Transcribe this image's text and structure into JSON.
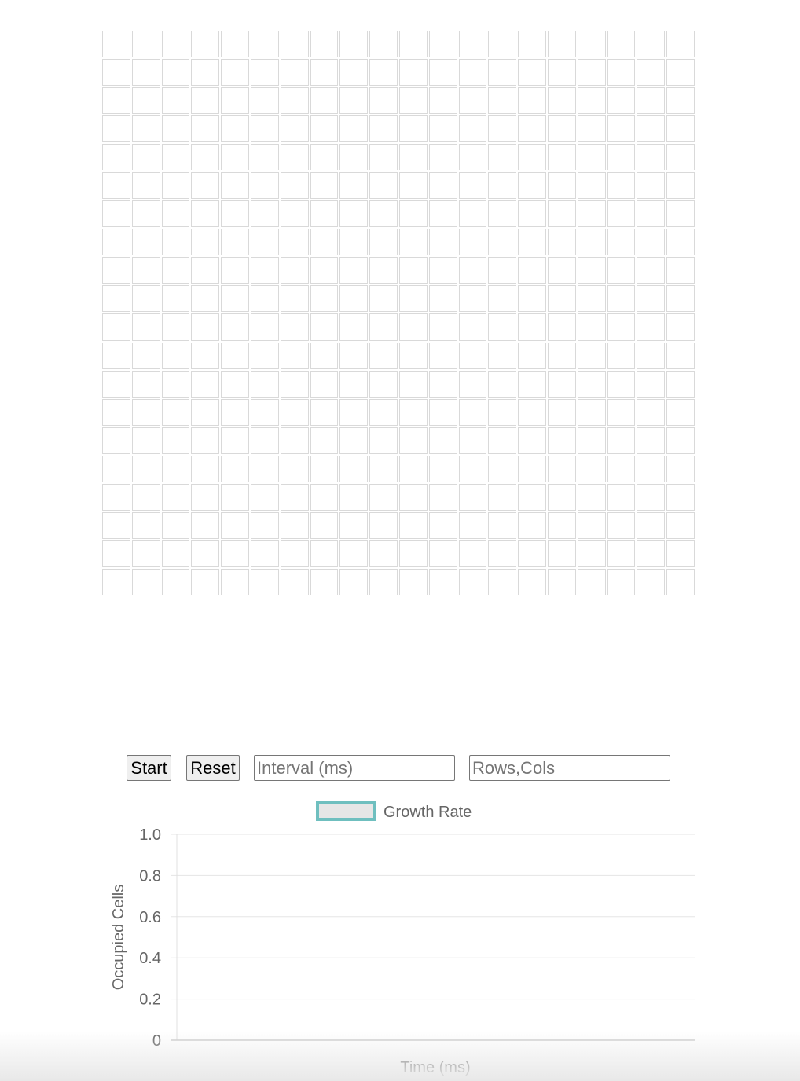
{
  "grid": {
    "rows": 20,
    "cols": 20
  },
  "controls": {
    "start_label": "Start",
    "reset_label": "Reset",
    "interval_placeholder": "Interval (ms)",
    "rows_cols_placeholder": "Rows,Cols"
  },
  "colors": {
    "series_border": "#6fbfbf",
    "series_fill": "#e6e6e6",
    "grid_line": "#e5e5e5",
    "axis_text": "#666666"
  },
  "chart_data": {
    "type": "line",
    "series": [
      {
        "name": "Growth Rate",
        "x": [],
        "values": []
      }
    ],
    "xlabel": "Time (ms)",
    "ylabel": "Occupied Cells",
    "ylim": [
      0,
      1
    ],
    "yticks": [
      "0",
      "0.2",
      "0.4",
      "0.6",
      "0.8",
      "1.0"
    ],
    "grid": true,
    "legend": "top-center"
  }
}
